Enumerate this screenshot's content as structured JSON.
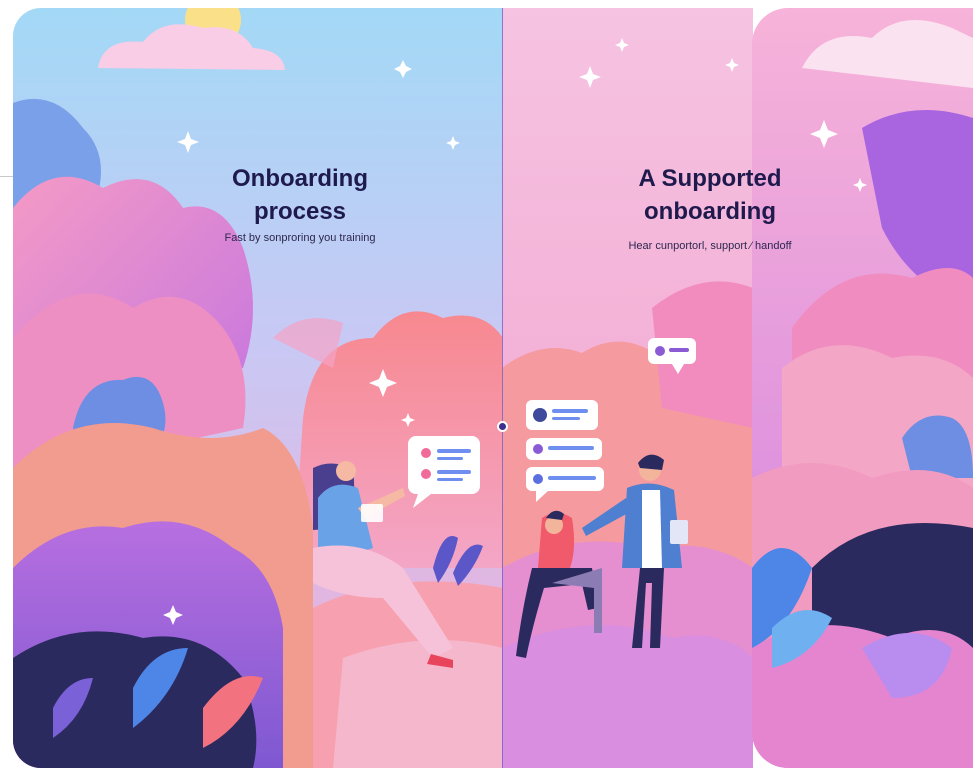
{
  "left_card": {
    "title": "Onboarding\nprocess",
    "subtitle": "Fast by sonproring you training"
  },
  "right_card": {
    "title": "A Supported\nonboarding",
    "subtitle": "Hear cunportorl, support ⁄ handoff"
  },
  "colors": {
    "sky_left": "#a7dcf5",
    "sky_right": "#f7bfe0",
    "heading": "#1f1a4d",
    "accent_purple": "#8b5bd6",
    "accent_pink": "#f06b9a",
    "deep_navy": "#2b2a5e",
    "divider": "#6d5bc9"
  },
  "icons": [
    "chat-bubble-icon",
    "avatar-icon",
    "sparkle-icon",
    "plant-icon",
    "cloud-icon",
    "sun-icon"
  ]
}
